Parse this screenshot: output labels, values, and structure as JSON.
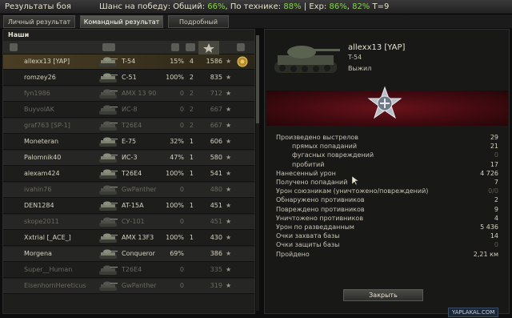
{
  "window": {
    "title": "Результаты боя",
    "chance_prefix": "Шанс на победу: Общий:",
    "chance_total": "66%",
    "chance_tech_label": ", По технике:",
    "chance_tech": "88%",
    "exp_label": "| Exp:",
    "exp_a": "86%",
    "exp_sep": ",",
    "exp_b": "82%",
    "tier": "T=9"
  },
  "tabs": [
    {
      "label": "Личный результат",
      "active": false
    },
    {
      "label": "Командный результат",
      "active": true
    },
    {
      "label": "Подробный отчёт",
      "active": false
    }
  ],
  "team": {
    "label": "Наши",
    "column_icons": [
      "vehicle-type-icon",
      "tank-icon",
      "damage-icon",
      "frags-icon",
      "experience-icon",
      "medal-icon"
    ],
    "rows": [
      {
        "name": "allexx13 [YAP]",
        "tank": "T-54",
        "pct": "15%",
        "frags": "4",
        "xp": "1586",
        "me": true,
        "dead": false,
        "medal": true
      },
      {
        "name": "romzey26",
        "tank": "С-51",
        "pct": "100%",
        "frags": "2",
        "xp": "835",
        "me": false,
        "dead": false,
        "medal": false
      },
      {
        "name": "fyn1986",
        "tank": "AMX 13 90",
        "pct": "0",
        "frags": "2",
        "xp": "712",
        "me": false,
        "dead": true,
        "medal": false
      },
      {
        "name": "BuyvolAK",
        "tank": "ИС-8",
        "pct": "0",
        "frags": "2",
        "xp": "667",
        "me": false,
        "dead": true,
        "medal": false
      },
      {
        "name": "graf763 [SP-1]",
        "tank": "T26E4",
        "pct": "0",
        "frags": "2",
        "xp": "667",
        "me": false,
        "dead": true,
        "medal": false
      },
      {
        "name": "Moneteran",
        "tank": "E-75",
        "pct": "32%",
        "frags": "1",
        "xp": "606",
        "me": false,
        "dead": false,
        "medal": false
      },
      {
        "name": "Palomnik40",
        "tank": "ИС-3",
        "pct": "47%",
        "frags": "1",
        "xp": "580",
        "me": false,
        "dead": false,
        "medal": false
      },
      {
        "name": "alexam424",
        "tank": "T26E4",
        "pct": "100%",
        "frags": "1",
        "xp": "541",
        "me": false,
        "dead": false,
        "medal": false
      },
      {
        "name": "ivahin76",
        "tank": "GwPanther",
        "pct": "0",
        "frags": "",
        "xp": "480",
        "me": false,
        "dead": true,
        "medal": false
      },
      {
        "name": "DEN1284",
        "tank": "AT-15A",
        "pct": "100%",
        "frags": "1",
        "xp": "451",
        "me": false,
        "dead": false,
        "medal": false
      },
      {
        "name": "skope2011",
        "tank": "СУ-101",
        "pct": "0",
        "frags": "",
        "xp": "451",
        "me": false,
        "dead": true,
        "medal": false
      },
      {
        "name": "Xxtrial [_ACE_]",
        "tank": "AMX 13F3",
        "pct": "100%",
        "frags": "1",
        "xp": "430",
        "me": false,
        "dead": false,
        "medal": false
      },
      {
        "name": "Morgena",
        "tank": "Conqueror",
        "pct": "69%",
        "frags": "",
        "xp": "386",
        "me": false,
        "dead": false,
        "medal": false
      },
      {
        "name": "Super__Human",
        "tank": "T26E4",
        "pct": "0",
        "frags": "",
        "xp": "335",
        "me": false,
        "dead": true,
        "medal": false
      },
      {
        "name": "EisenhornHereticus",
        "tank": "GwPanther",
        "pct": "0",
        "frags": "",
        "xp": "319",
        "me": false,
        "dead": true,
        "medal": false
      }
    ]
  },
  "player": {
    "name": "allexx13 [YAP]",
    "tank": "T-54",
    "status": "Выжил",
    "stats": [
      {
        "label": "Произведено выстрелов",
        "value": "29",
        "indent": false,
        "dim": false
      },
      {
        "label": "прямых попаданий",
        "value": "21",
        "indent": true,
        "dim": false
      },
      {
        "label": "фугасных повреждений",
        "value": "0",
        "indent": true,
        "dim": true
      },
      {
        "label": "пробитий",
        "value": "17",
        "indent": true,
        "dim": false
      },
      {
        "label": "Нанесенный урон",
        "value": "4 726",
        "indent": false,
        "dim": false
      },
      {
        "label": "Получено попаданий",
        "value": "7",
        "indent": false,
        "dim": false
      },
      {
        "label": "Урон союзникам (уничтожено/повреждений)",
        "value": "0/0",
        "indent": false,
        "dim": true
      },
      {
        "label": "Обнаружено противников",
        "value": "2",
        "indent": false,
        "dim": false
      },
      {
        "label": "Повреждено противников",
        "value": "9",
        "indent": false,
        "dim": false
      },
      {
        "label": "Уничтожено противников",
        "value": "4",
        "indent": false,
        "dim": false
      },
      {
        "label": "Урон по разведданным",
        "value": "5 436",
        "indent": false,
        "dim": false
      },
      {
        "label": "Очки захвата базы",
        "value": "14",
        "indent": false,
        "dim": false
      },
      {
        "label": "Очки защиты базы",
        "value": "0",
        "indent": false,
        "dim": true
      },
      {
        "label": "Пройдено",
        "value": "2,21 км",
        "indent": false,
        "dim": false
      }
    ],
    "close_label": "Закрыть"
  },
  "watermark": "YAPLAKAL.COM",
  "colors": {
    "accent_green": "#86d34a",
    "panel_red": "#5a0f16",
    "highlight_row": "#4a3e24"
  }
}
